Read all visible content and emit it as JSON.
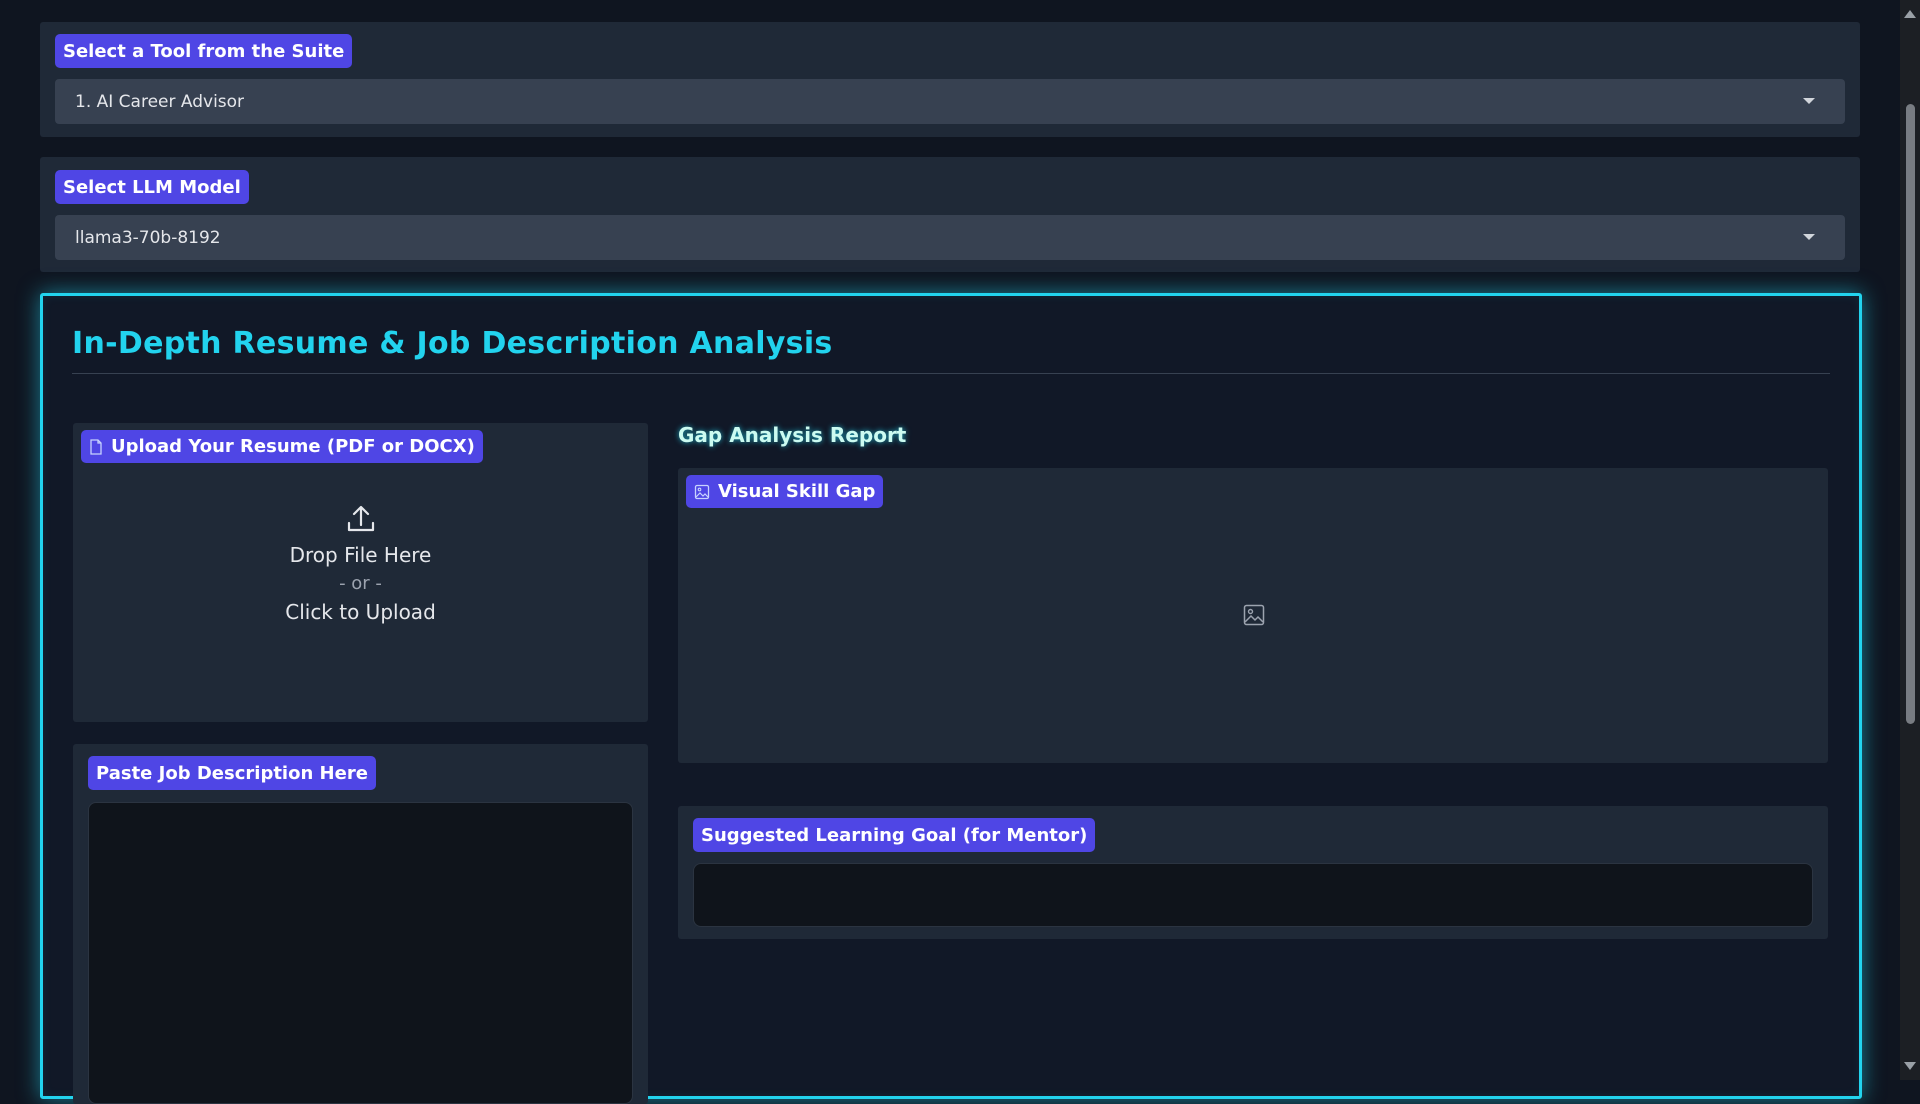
{
  "tool_select": {
    "label": "Select a Tool from the Suite",
    "value": "1. AI Career Advisor"
  },
  "model_select": {
    "label": "Select LLM Model",
    "value": "llama3-70b-8192"
  },
  "panel": {
    "title": "In-Depth Resume & Job Description Analysis",
    "accent_color": "#22d3ee"
  },
  "resume_upload": {
    "label": "Upload Your Resume (PDF or DOCX)",
    "drop_text": "Drop File Here",
    "or_text": "- or -",
    "click_text": "Click to Upload"
  },
  "job_description": {
    "label": "Paste Job Description Here",
    "value": ""
  },
  "report": {
    "heading": "Gap Analysis Report",
    "visual_label": "Visual Skill Gap",
    "goal_label": "Suggested Learning Goal (for Mentor)",
    "goal_value": ""
  },
  "icons": {
    "file": "file-icon",
    "image": "image-icon",
    "upload": "upload-icon",
    "dropdown": "chevron-down-icon"
  },
  "colors": {
    "label_bg": "#4f46e5",
    "background": "#0f1520",
    "card": "#1f2937"
  }
}
